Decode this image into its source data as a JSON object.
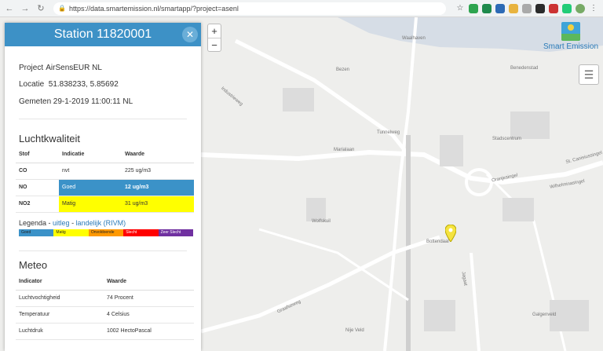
{
  "browser": {
    "url": "https://data.smartemission.nl/smartapp/?project=asenl"
  },
  "map": {
    "labels": [
      "Waalhaven",
      "Bezen",
      "Benedenstad",
      "Industrieweg",
      "Marialaan",
      "Tunnelweg",
      "Stadscentrum",
      "Oranjesingel",
      "St. Canisiussingel",
      "Wolfskuil",
      "Bottendaal",
      "Graafseweg",
      "Nije Veld",
      "Galgenveld",
      "Wilhelminasingel",
      "Jagaat"
    ],
    "zoom_in": "+",
    "zoom_out": "−",
    "brand": "Smart Emission"
  },
  "panel": {
    "title": "Station 11820001",
    "project_label": "Project",
    "project_value": "AirSensEUR NL",
    "location_label": "Locatie",
    "location_value": "51.838233, 5.85692",
    "measured_label": "Gemeten",
    "measured_value": "29-1-2019 11:00:11 NL",
    "air_quality_title": "Luchtkwaliteit",
    "aq_headers": [
      "Stof",
      "Indicatie",
      "Waarde"
    ],
    "aq_rows": [
      {
        "stof": "CO",
        "indicatie": "nvt",
        "waarde": "225 ug/m3",
        "color": "#ffffff"
      },
      {
        "stof": "NO",
        "indicatie": "Goed",
        "waarde": "12 ug/m3",
        "color": "#3b92c8"
      },
      {
        "stof": "NO2",
        "indicatie": "Matig",
        "waarde": "31 ug/m3",
        "color": "#ffff00"
      }
    ],
    "legend_label": "Legenda - ",
    "legend_link1": "uitleg",
    "legend_sep": " - ",
    "legend_link2": "landelijk (RIVM)",
    "legend_items": [
      {
        "label": "Goed",
        "color": "#3b92c8"
      },
      {
        "label": "Matig",
        "color": "#ffff00"
      },
      {
        "label": "Onvoldoende",
        "color": "#ff9900"
      },
      {
        "label": "Slecht",
        "color": "#ff0000"
      },
      {
        "label": "Zeer Slecht",
        "color": "#7030a0"
      }
    ],
    "meteo_title": "Meteo",
    "meteo_headers": [
      "Indicator",
      "Waarde"
    ],
    "meteo_rows": [
      {
        "indicator": "Luchtvochtigheid",
        "waarde": "74 Procent"
      },
      {
        "indicator": "Temperatuur",
        "waarde": "4 Celsius"
      },
      {
        "indicator": "Luchtdruk",
        "waarde": "1002 HectoPascal"
      }
    ]
  }
}
